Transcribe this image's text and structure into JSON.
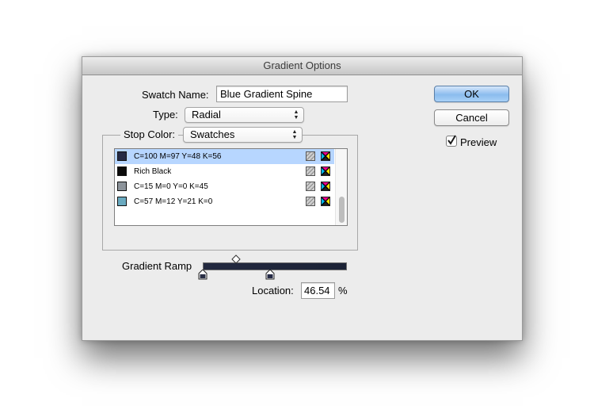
{
  "dialog": {
    "title": "Gradient Options"
  },
  "swatch_name": {
    "label": "Swatch Name:",
    "value": "Blue Gradient Spine"
  },
  "type": {
    "label": "Type:",
    "selected": "Radial"
  },
  "stop_color": {
    "label": "Stop Color:",
    "selected": "Swatches"
  },
  "swatch_list": [
    {
      "label": "C=100 M=97 Y=48 K=56",
      "color": "#252a45",
      "selected": true
    },
    {
      "label": "Rich Black",
      "color": "#0b0b0b",
      "selected": false
    },
    {
      "label": "C=15 M=0 Y=0 K=45",
      "color": "#8d949b",
      "selected": false
    },
    {
      "label": "C=57 M=12 Y=21 K=0",
      "color": "#6aaac0",
      "selected": false
    }
  ],
  "gradient_ramp": {
    "label": "Gradient Ramp",
    "midpoint_percent": 23,
    "stops": [
      {
        "position_percent": 0,
        "color": "#2a2f45"
      },
      {
        "position_percent": 46.54,
        "color": "#252a45"
      }
    ]
  },
  "location": {
    "label": "Location:",
    "value": "46.54",
    "unit": "%"
  },
  "buttons": {
    "ok": "OK",
    "cancel": "Cancel"
  },
  "preview": {
    "label": "Preview",
    "checked": true
  },
  "colors": {
    "selection": "#b7d6ff",
    "default_button": "#8bbcee"
  }
}
